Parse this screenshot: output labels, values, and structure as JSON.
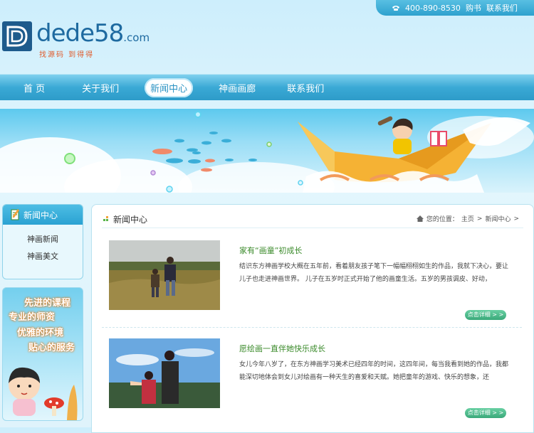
{
  "topbar": {
    "phone": "400-890-8530",
    "links": [
      "购书",
      "联系我们"
    ]
  },
  "logo": {
    "word": "dede58",
    "tld": ".com",
    "slogan": "找源码 到得得"
  },
  "nav": {
    "items": [
      "首 页",
      "关于我们",
      "新闻中心",
      "神画画廊",
      "联系我们"
    ],
    "active": "新闻中心"
  },
  "sidebar": {
    "title": "新闻中心",
    "links": [
      "神画新闻",
      "神画美文"
    ]
  },
  "promo": {
    "lines": [
      "先进的课程",
      "专业的师资",
      "优雅的环境",
      "贴心的服务"
    ]
  },
  "content": {
    "title": "新闻中心",
    "breadcrumb": {
      "prefix": "您的位置：",
      "home": "主页",
      "sep": ">",
      "current": "新闻中心",
      "trail": ">"
    },
    "articles": [
      {
        "title": "家有“画童”初成长",
        "body": "结识东方神画学校大概在五年前，看着朋友孩子笔下一幅幅栩栩如生的作品，我就下决心，要让儿子也走进神画世界。 儿子在五岁时正式开始了他的画童生活。五岁的男孩调皮、好动，",
        "more": "点击详细 > >"
      },
      {
        "title": "愿绘画一直伴她快乐成长",
        "body": "女儿今年八岁了，在东方神画学习美术已经四年的时间，这四年间，每当我看到她的作品，我都能深切地体会到女儿对绘画有一种天生的喜爱和天赋。她把童年的游戏、快乐的想象，还",
        "more": "点击详细 > >"
      }
    ]
  },
  "colors": {
    "nav": "#3aa9d5",
    "accent_green": "#3aa97a",
    "title_green": "#3a8a2a"
  }
}
